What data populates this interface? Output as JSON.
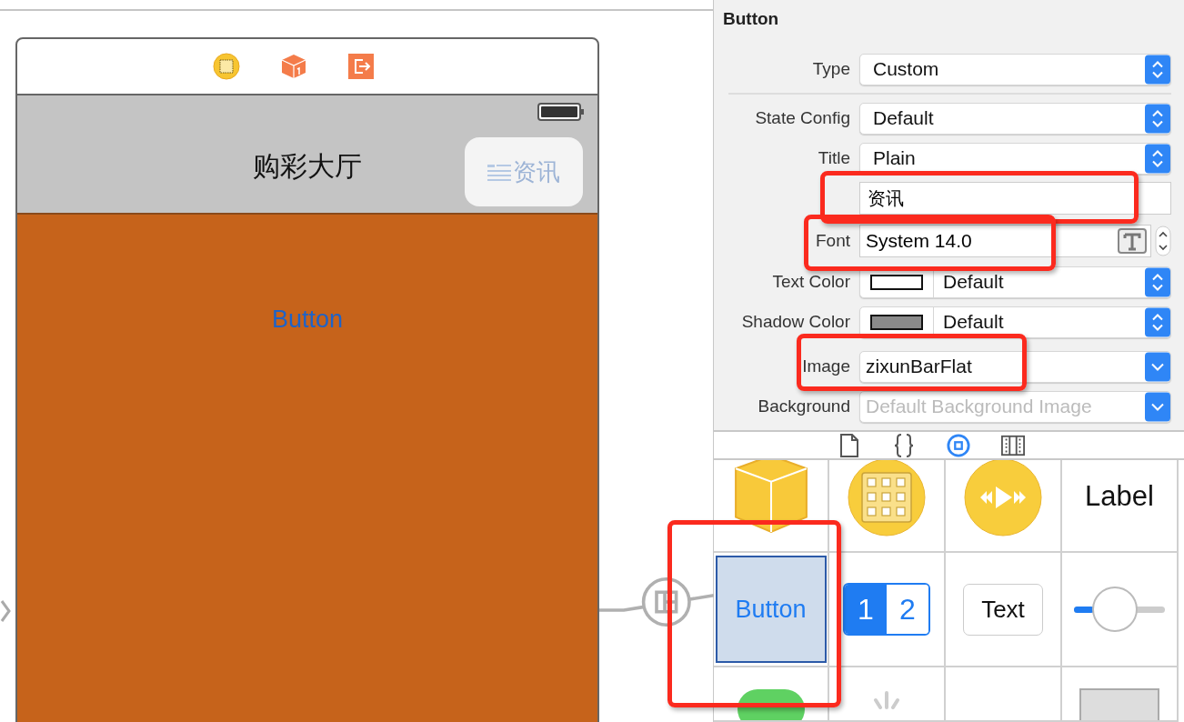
{
  "phone": {
    "nav_title": "购彩大厅",
    "nav_button": "资讯",
    "body_button": "Button"
  },
  "inspector": {
    "section": "Button",
    "rows": [
      {
        "kind": "popup",
        "label": "Type",
        "value": "Custom"
      },
      {
        "kind": "separator"
      },
      {
        "kind": "popup",
        "label": "State Config",
        "value": "Default"
      },
      {
        "kind": "popup",
        "label": "Title",
        "value": "Plain"
      },
      {
        "kind": "text",
        "value": "资讯"
      },
      {
        "kind": "font",
        "label": "Font",
        "value": "System 14.0"
      },
      {
        "kind": "color",
        "label": "Text Color",
        "color": "#ffffff",
        "value": "Default"
      },
      {
        "kind": "color",
        "label": "Shadow Color",
        "color": "#8a8a8a",
        "value": "Default"
      },
      {
        "kind": "combo",
        "label": "Image",
        "value": "zixunBarFlat"
      },
      {
        "kind": "combo",
        "label": "Background",
        "placeholder": "Default Background Image"
      }
    ]
  },
  "inspector_tabs": [
    {
      "kind": "file",
      "selected": false
    },
    {
      "kind": "braces",
      "selected": false
    },
    {
      "kind": "object",
      "selected": true
    },
    {
      "kind": "media",
      "selected": false
    }
  ],
  "library": [
    {
      "kind": "cube"
    },
    {
      "kind": "grid"
    },
    {
      "kind": "media"
    },
    {
      "kind": "label",
      "text": "Label"
    },
    {
      "kind": "button",
      "text": "Button",
      "selected": true
    },
    {
      "kind": "segmented",
      "segments": [
        {
          "label": "1",
          "selected": true
        },
        {
          "label": "2",
          "selected": false
        }
      ]
    },
    {
      "kind": "textfield",
      "text": "Text"
    },
    {
      "kind": "slider",
      "level": 0.22
    },
    {
      "kind": "switch"
    },
    {
      "kind": "activity"
    },
    {
      "kind": "empty"
    },
    {
      "kind": "imageview"
    }
  ]
}
